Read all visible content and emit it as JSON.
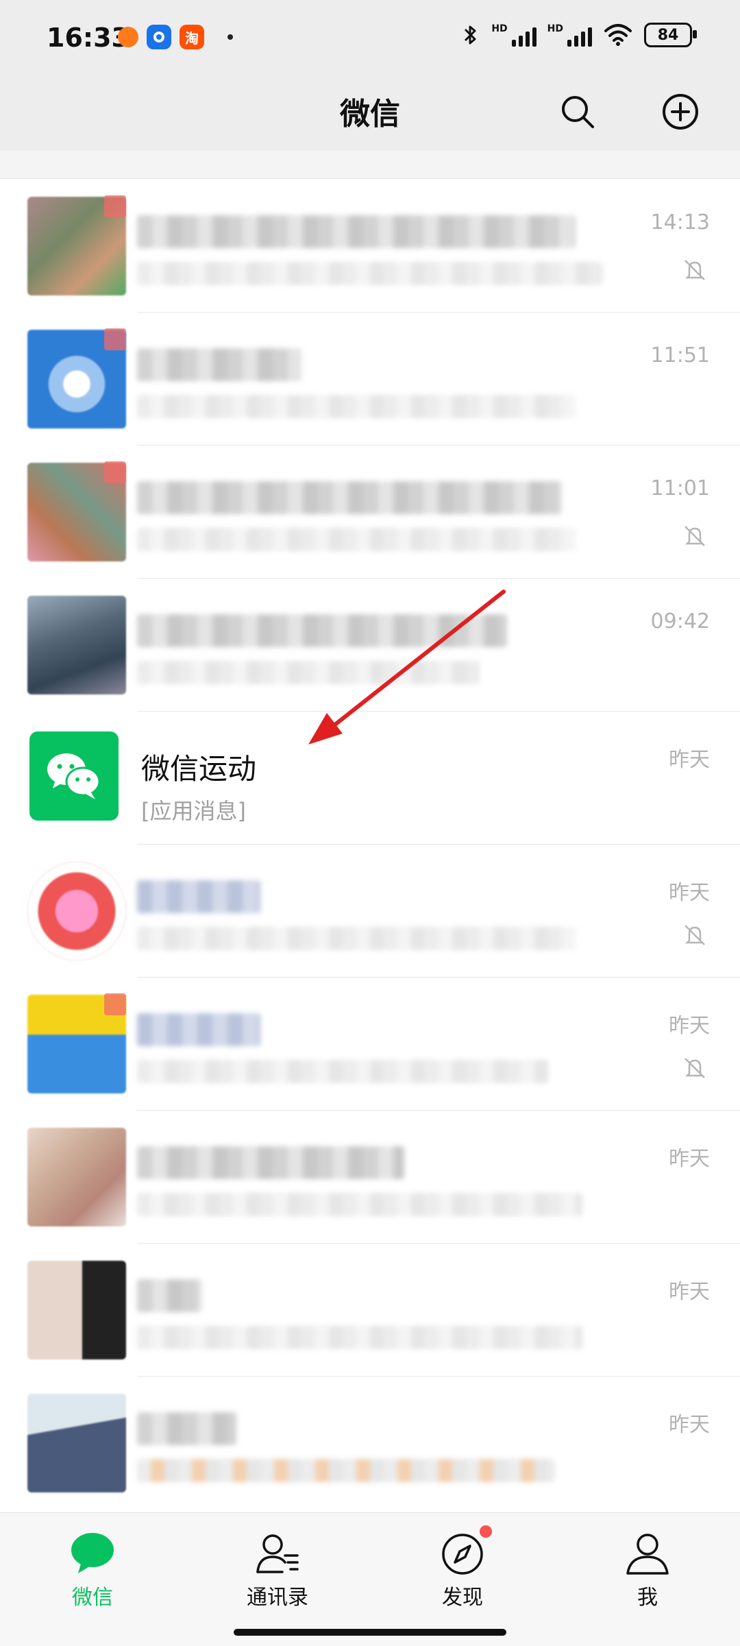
{
  "status_bar": {
    "time": "16:33",
    "battery": "84",
    "signal_label": "HD",
    "app_icon_label": "淘"
  },
  "header": {
    "title": "微信"
  },
  "chats": [
    {
      "time": "14:13",
      "muted": true
    },
    {
      "time": "11:51",
      "muted": false
    },
    {
      "time": "11:01",
      "muted": true
    },
    {
      "time": "09:42",
      "muted": false
    },
    {
      "name": "微信运动",
      "preview": "[应用消息]",
      "time": "昨天",
      "muted": false
    },
    {
      "time": "昨天",
      "muted": true
    },
    {
      "time": "昨天",
      "muted": true
    },
    {
      "time": "昨天",
      "muted": false
    },
    {
      "time": "昨天",
      "muted": false
    },
    {
      "time": "昨天",
      "muted": false
    }
  ],
  "tabs": [
    {
      "label": "微信"
    },
    {
      "label": "通讯录"
    },
    {
      "label": "发现"
    },
    {
      "label": "我"
    }
  ],
  "colors": {
    "accent": "#07c160",
    "arrow": "#e02020",
    "badge": "#fa5151"
  }
}
